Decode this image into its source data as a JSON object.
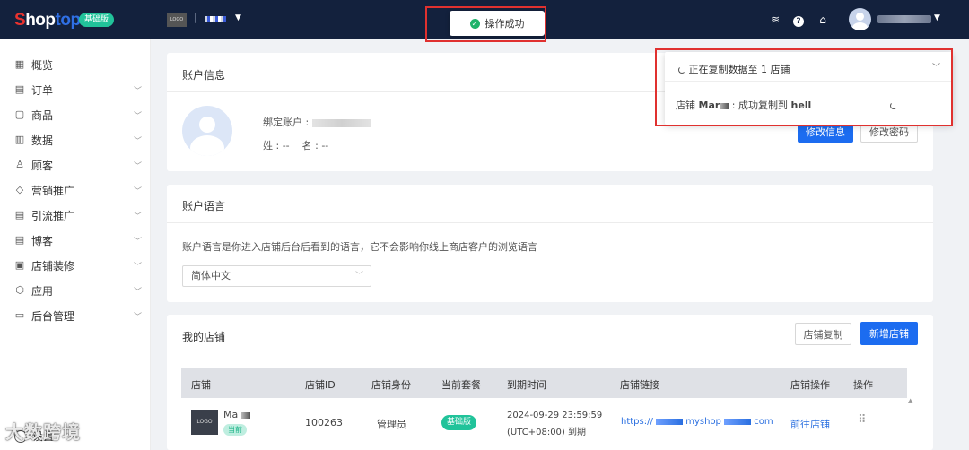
{
  "app": {
    "logo_part1": "S",
    "logo_part2": "hop",
    "logo_part3": "top",
    "edition": "基础版",
    "store_logo": "LOGO",
    "store_sep": "|"
  },
  "toast": {
    "text": "操作成功"
  },
  "sidebar": {
    "items": [
      {
        "label": "概览",
        "icon": "dashboard-icon",
        "glyph": "▦",
        "caret": false
      },
      {
        "label": "订单",
        "icon": "order-icon",
        "glyph": "▤",
        "caret": true
      },
      {
        "label": "商品",
        "icon": "product-icon",
        "glyph": "▢",
        "caret": true
      },
      {
        "label": "数据",
        "icon": "data-icon",
        "glyph": "▥",
        "caret": true
      },
      {
        "label": "顾客",
        "icon": "customer-icon",
        "glyph": "♙",
        "caret": true
      },
      {
        "label": "营销推广",
        "icon": "tag-icon",
        "glyph": "◇",
        "caret": true
      },
      {
        "label": "引流推广",
        "icon": "traffic-icon",
        "glyph": "▤",
        "caret": true
      },
      {
        "label": "博客",
        "icon": "blog-icon",
        "glyph": "▤",
        "caret": true
      },
      {
        "label": "店铺装修",
        "icon": "decoration-icon",
        "glyph": "▣",
        "caret": true
      },
      {
        "label": "应用",
        "icon": "app-icon",
        "glyph": "⬡",
        "caret": true
      },
      {
        "label": "后台管理",
        "icon": "folder-icon",
        "glyph": "▭",
        "caret": true
      }
    ],
    "settings_label": "设置",
    "watermark": "大数跨境"
  },
  "account": {
    "title": "账户信息",
    "bound_label": "绑定账户 :",
    "surname_label": "姓 : --",
    "name_label": "名 : --",
    "edit_info": "修改信息",
    "edit_password": "修改密码"
  },
  "language": {
    "title": "账户语言",
    "description": "账户语言是你进入店铺后台后看到的语言，它不会影响你线上商店客户的浏览语言",
    "selected": "简体中文"
  },
  "stores": {
    "title": "我的店铺",
    "copy_button": "店铺复制",
    "new_button": "新增店铺",
    "columns": [
      "店铺",
      "店铺ID",
      "店铺身份",
      "当前套餐",
      "到期时间",
      "店铺链接",
      "店铺操作",
      "操作"
    ],
    "rows": [
      {
        "logo": "LOGO",
        "name": "Ma",
        "current_badge": "当前",
        "id": "100263",
        "role": "管理员",
        "plan": "基础版",
        "expire_line1": "2024-09-29 23:59:59",
        "expire_line2": "(UTC+08:00) 到期",
        "link_prefix": "https://",
        "link_mid": "myshop",
        "link_suffix": "com",
        "action": "前往店铺"
      }
    ]
  },
  "copy_panel": {
    "title": "正在复制数据至 1 店铺",
    "line_prefix": "店铺",
    "line_store": "Mar",
    "line_middle": ": 成功复制到",
    "line_target": "hell"
  },
  "colors": {
    "topbar": "#13213d",
    "primary": "#1c6cf0",
    "badge_green": "#21c39a",
    "highlight_red": "#e0312f"
  }
}
